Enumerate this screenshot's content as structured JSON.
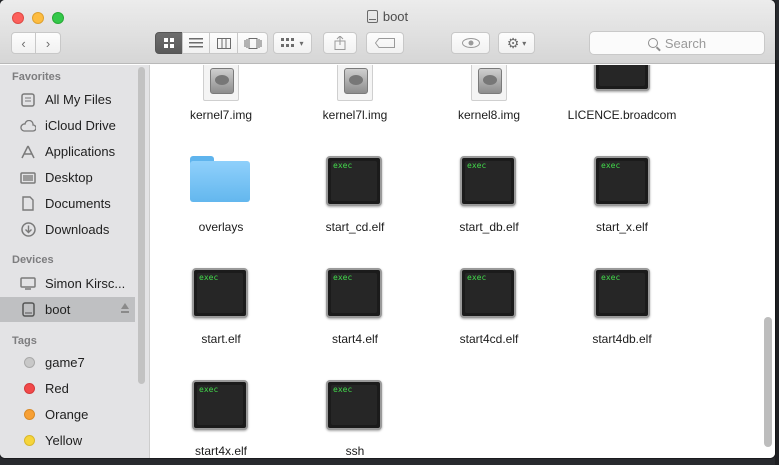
{
  "window": {
    "title": "boot"
  },
  "toolbar": {
    "search_placeholder": "Search"
  },
  "sidebar": {
    "favorites_header": "Favorites",
    "favorites": [
      {
        "label": "All My Files",
        "icon": "all-files-icon"
      },
      {
        "label": "iCloud Drive",
        "icon": "cloud-icon"
      },
      {
        "label": "Applications",
        "icon": "applications-icon"
      },
      {
        "label": "Desktop",
        "icon": "desktop-icon"
      },
      {
        "label": "Documents",
        "icon": "documents-icon"
      },
      {
        "label": "Downloads",
        "icon": "downloads-icon"
      }
    ],
    "devices_header": "Devices",
    "devices": [
      {
        "label": "Simon Kirsc...",
        "icon": "computer-icon"
      },
      {
        "label": "boot",
        "icon": "drive-icon"
      }
    ],
    "tags_header": "Tags",
    "tags": [
      {
        "label": "game7",
        "color": "#c8c8c8"
      },
      {
        "label": "Red",
        "color": "#f2494a"
      },
      {
        "label": "Orange",
        "color": "#f7a035"
      },
      {
        "label": "Yellow",
        "color": "#f6d53b"
      }
    ]
  },
  "files": [
    {
      "name": "kernel7.img",
      "kind": "disk-image"
    },
    {
      "name": "kernel7l.img",
      "kind": "disk-image"
    },
    {
      "name": "kernel8.img",
      "kind": "disk-image"
    },
    {
      "name": "LICENCE.broadcom",
      "kind": "exec"
    },
    {
      "name": "overlays",
      "kind": "folder"
    },
    {
      "name": "start_cd.elf",
      "kind": "exec"
    },
    {
      "name": "start_db.elf",
      "kind": "exec"
    },
    {
      "name": "start_x.elf",
      "kind": "exec"
    },
    {
      "name": "start.elf",
      "kind": "exec"
    },
    {
      "name": "start4.elf",
      "kind": "exec"
    },
    {
      "name": "start4cd.elf",
      "kind": "exec"
    },
    {
      "name": "start4db.elf",
      "kind": "exec"
    },
    {
      "name": "start4x.elf",
      "kind": "exec"
    },
    {
      "name": "ssh",
      "kind": "exec"
    }
  ],
  "exec_badge": "exec",
  "selected_device_index": 1
}
